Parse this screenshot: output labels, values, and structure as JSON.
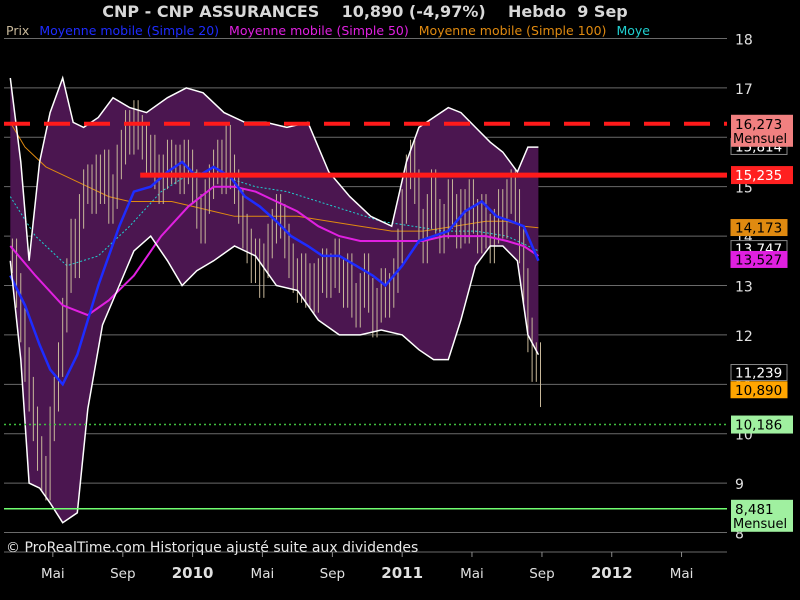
{
  "header": {
    "title": "CNP - CNP ASSURANCES    10,890 (-4,97%)    Hebdo  9 Sep"
  },
  "legend": [
    {
      "label": "Prix",
      "color": "#c8b89a"
    },
    {
      "label": "Moyenne mobile (Simple 20)",
      "color": "#1e2cff"
    },
    {
      "label": "Moyenne mobile (Simple 50)",
      "color": "#e020e0"
    },
    {
      "label": "Moyenne mobile (Simple 100)",
      "color": "#e08a10"
    },
    {
      "label": "Moye",
      "color": "#20d0d0"
    }
  ],
  "credit": "© ProRealTime.com Historique ajusté suite aux dividendes",
  "chart_data": {
    "type": "line",
    "colors": {
      "band_fill": "#4b1650",
      "band_edge": "#ffffff",
      "price": "#c8b89a",
      "sma20": "#1e2cff",
      "sma50": "#e020e0",
      "sma100": "#e08a10",
      "sma200": "#20d0d0",
      "resistance": "#ff1a1a",
      "support_dotted": "#40c040",
      "support_solid": "#70ff70"
    },
    "ylim": [
      7.9,
      18.1
    ],
    "yticks": [
      8,
      9,
      10,
      11,
      12,
      13,
      14,
      15,
      16,
      17,
      18
    ],
    "xlim": [
      2009.1,
      2012.55
    ],
    "xticks": [
      {
        "x": 2009.333,
        "label": "Mai",
        "bold": false
      },
      {
        "x": 2009.667,
        "label": "Sep",
        "bold": false
      },
      {
        "x": 2010.0,
        "label": "2010",
        "bold": true
      },
      {
        "x": 2010.333,
        "label": "Mai",
        "bold": false
      },
      {
        "x": 2010.667,
        "label": "Sep",
        "bold": false
      },
      {
        "x": 2011.0,
        "label": "2011",
        "bold": true
      },
      {
        "x": 2011.333,
        "label": "Mai",
        "bold": false
      },
      {
        "x": 2011.667,
        "label": "Sep",
        "bold": false
      },
      {
        "x": 2012.0,
        "label": "2012",
        "bold": true
      },
      {
        "x": 2012.333,
        "label": "Mai",
        "bold": false
      }
    ],
    "levels": [
      {
        "y": 16.273,
        "style": "dashed",
        "color": "#ff1a1a",
        "label": "16,273",
        "sublabel": "Mensuel",
        "box": "#f08080",
        "text": "#000000"
      },
      {
        "y": 15.235,
        "style": "solid",
        "color": "#ff1a1a",
        "x_from": 2009.75,
        "label": "15,235",
        "sublabel": "",
        "box": "#ff2020",
        "text": "#ffffff"
      },
      {
        "y": 10.186,
        "style": "dotted",
        "color": "#40c040",
        "label": "10,186",
        "sublabel": "",
        "box": "#a0f0a0",
        "text": "#000000"
      },
      {
        "y": 8.481,
        "style": "solid",
        "color": "#70ff70",
        "label": "8,481",
        "sublabel": "Mensuel",
        "box": "#a0f0a0",
        "text": "#000000"
      }
    ],
    "value_tags": [
      {
        "label": "15,814",
        "y": 15.814,
        "box": "#000000",
        "text": "#ffffff",
        "border": "#888888"
      },
      {
        "label": "14,173",
        "y": 14.173,
        "box": "#e08a10",
        "text": "#000000",
        "border": "#e08a10"
      },
      {
        "label": "13,747",
        "y": 13.747,
        "box": "#000000",
        "text": "#ffffff",
        "border": "#888888"
      },
      {
        "label": "13,527",
        "y": 13.527,
        "box": "#e020e0",
        "text": "#000000",
        "border": "#e020e0"
      },
      {
        "label": "11,239",
        "y": 11.239,
        "box": "#000000",
        "text": "#ffffff",
        "border": "#888888"
      },
      {
        "label": "10,890",
        "y": 10.89,
        "box": "#ffa500",
        "text": "#000000",
        "border": "#ffa500"
      }
    ],
    "bollinger_upper": [
      [
        2009.13,
        17.2
      ],
      [
        2009.18,
        15.5
      ],
      [
        2009.22,
        13.5
      ],
      [
        2009.27,
        15.5
      ],
      [
        2009.32,
        16.5
      ],
      [
        2009.38,
        17.2
      ],
      [
        2009.43,
        16.3
      ],
      [
        2009.48,
        16.2
      ],
      [
        2009.55,
        16.4
      ],
      [
        2009.62,
        16.8
      ],
      [
        2009.7,
        16.6
      ],
      [
        2009.78,
        16.5
      ],
      [
        2009.88,
        16.8
      ],
      [
        2009.97,
        17.0
      ],
      [
        2010.05,
        16.9
      ],
      [
        2010.15,
        16.5
      ],
      [
        2010.25,
        16.3
      ],
      [
        2010.35,
        16.3
      ],
      [
        2010.45,
        16.2
      ],
      [
        2010.55,
        16.3
      ],
      [
        2010.65,
        15.3
      ],
      [
        2010.75,
        14.8
      ],
      [
        2010.85,
        14.4
      ],
      [
        2010.95,
        14.2
      ],
      [
        2011.02,
        15.5
      ],
      [
        2011.08,
        16.2
      ],
      [
        2011.15,
        16.4
      ],
      [
        2011.22,
        16.6
      ],
      [
        2011.28,
        16.5
      ],
      [
        2011.35,
        16.2
      ],
      [
        2011.42,
        15.9
      ],
      [
        2011.48,
        15.7
      ],
      [
        2011.55,
        15.3
      ],
      [
        2011.6,
        15.8
      ],
      [
        2011.65,
        15.8
      ]
    ],
    "bollinger_lower": [
      [
        2009.13,
        13.5
      ],
      [
        2009.18,
        11.5
      ],
      [
        2009.22,
        9.0
      ],
      [
        2009.27,
        8.9
      ],
      [
        2009.32,
        8.6
      ],
      [
        2009.38,
        8.2
      ],
      [
        2009.45,
        8.4
      ],
      [
        2009.5,
        10.5
      ],
      [
        2009.57,
        12.2
      ],
      [
        2009.65,
        13.0
      ],
      [
        2009.72,
        13.7
      ],
      [
        2009.8,
        14.0
      ],
      [
        2009.88,
        13.5
      ],
      [
        2009.95,
        13.0
      ],
      [
        2010.02,
        13.3
      ],
      [
        2010.1,
        13.5
      ],
      [
        2010.2,
        13.8
      ],
      [
        2010.3,
        13.6
      ],
      [
        2010.4,
        13.0
      ],
      [
        2010.5,
        12.9
      ],
      [
        2010.6,
        12.3
      ],
      [
        2010.7,
        12.0
      ],
      [
        2010.8,
        12.0
      ],
      [
        2010.9,
        12.1
      ],
      [
        2011.0,
        12.0
      ],
      [
        2011.08,
        11.7
      ],
      [
        2011.15,
        11.5
      ],
      [
        2011.22,
        11.5
      ],
      [
        2011.28,
        12.3
      ],
      [
        2011.35,
        13.4
      ],
      [
        2011.42,
        13.8
      ],
      [
        2011.48,
        13.8
      ],
      [
        2011.55,
        13.5
      ],
      [
        2011.6,
        12.0
      ],
      [
        2011.65,
        11.6
      ]
    ],
    "sma20": [
      [
        2009.13,
        13.2
      ],
      [
        2009.2,
        12.6
      ],
      [
        2009.27,
        11.8
      ],
      [
        2009.32,
        11.3
      ],
      [
        2009.38,
        11.0
      ],
      [
        2009.45,
        11.6
      ],
      [
        2009.55,
        13.0
      ],
      [
        2009.65,
        14.2
      ],
      [
        2009.72,
        14.9
      ],
      [
        2009.8,
        15.0
      ],
      [
        2009.88,
        15.3
      ],
      [
        2009.95,
        15.5
      ],
      [
        2010.02,
        15.2
      ],
      [
        2010.1,
        15.4
      ],
      [
        2010.18,
        15.2
      ],
      [
        2010.25,
        14.8
      ],
      [
        2010.32,
        14.6
      ],
      [
        2010.4,
        14.3
      ],
      [
        2010.47,
        14.0
      ],
      [
        2010.55,
        13.8
      ],
      [
        2010.62,
        13.6
      ],
      [
        2010.7,
        13.6
      ],
      [
        2010.78,
        13.4
      ],
      [
        2010.86,
        13.2
      ],
      [
        2010.92,
        13.0
      ],
      [
        2011.0,
        13.4
      ],
      [
        2011.08,
        13.9
      ],
      [
        2011.15,
        14.0
      ],
      [
        2011.22,
        14.1
      ],
      [
        2011.3,
        14.5
      ],
      [
        2011.38,
        14.7
      ],
      [
        2011.45,
        14.4
      ],
      [
        2011.52,
        14.3
      ],
      [
        2011.58,
        14.2
      ],
      [
        2011.65,
        13.5
      ]
    ],
    "sma50": [
      [
        2009.13,
        13.8
      ],
      [
        2009.25,
        13.2
      ],
      [
        2009.38,
        12.6
      ],
      [
        2009.5,
        12.4
      ],
      [
        2009.6,
        12.7
      ],
      [
        2009.72,
        13.2
      ],
      [
        2009.85,
        14.0
      ],
      [
        2009.98,
        14.6
      ],
      [
        2010.1,
        15.0
      ],
      [
        2010.2,
        15.0
      ],
      [
        2010.3,
        14.9
      ],
      [
        2010.4,
        14.7
      ],
      [
        2010.5,
        14.5
      ],
      [
        2010.6,
        14.2
      ],
      [
        2010.7,
        14.0
      ],
      [
        2010.8,
        13.9
      ],
      [
        2010.9,
        13.9
      ],
      [
        2011.0,
        13.9
      ],
      [
        2011.1,
        13.9
      ],
      [
        2011.2,
        14.0
      ],
      [
        2011.3,
        14.0
      ],
      [
        2011.4,
        14.0
      ],
      [
        2011.5,
        13.9
      ],
      [
        2011.58,
        13.8
      ],
      [
        2011.65,
        13.6
      ]
    ],
    "sma100": [
      [
        2009.13,
        16.3
      ],
      [
        2009.2,
        15.8
      ],
      [
        2009.3,
        15.4
      ],
      [
        2009.4,
        15.2
      ],
      [
        2009.5,
        15.0
      ],
      [
        2009.6,
        14.8
      ],
      [
        2009.7,
        14.7
      ],
      [
        2009.8,
        14.7
      ],
      [
        2009.9,
        14.7
      ],
      [
        2010.0,
        14.6
      ],
      [
        2010.1,
        14.5
      ],
      [
        2010.2,
        14.4
      ],
      [
        2010.35,
        14.4
      ],
      [
        2010.5,
        14.4
      ],
      [
        2010.65,
        14.3
      ],
      [
        2010.8,
        14.2
      ],
      [
        2010.95,
        14.1
      ],
      [
        2011.1,
        14.1
      ],
      [
        2011.25,
        14.2
      ],
      [
        2011.4,
        14.3
      ],
      [
        2011.5,
        14.3
      ],
      [
        2011.58,
        14.2
      ],
      [
        2011.65,
        14.17
      ]
    ],
    "sma200": [
      [
        2009.13,
        14.8
      ],
      [
        2009.25,
        14.0
      ],
      [
        2009.4,
        13.4
      ],
      [
        2009.55,
        13.6
      ],
      [
        2009.7,
        14.2
      ],
      [
        2009.85,
        14.9
      ],
      [
        2010.0,
        15.3
      ],
      [
        2010.15,
        15.2
      ],
      [
        2010.3,
        15.0
      ],
      [
        2010.45,
        14.9
      ],
      [
        2010.6,
        14.7
      ],
      [
        2010.75,
        14.5
      ],
      [
        2010.9,
        14.3
      ],
      [
        2011.05,
        14.2
      ],
      [
        2011.2,
        14.1
      ],
      [
        2011.35,
        14.1
      ],
      [
        2011.5,
        14.0
      ],
      [
        2011.65,
        13.7
      ]
    ],
    "price_weekly": [
      [
        2009.14,
        13.6
      ],
      [
        2009.16,
        12.9
      ],
      [
        2009.18,
        12.2
      ],
      [
        2009.2,
        11.4
      ],
      [
        2009.22,
        10.8
      ],
      [
        2009.24,
        10.2
      ],
      [
        2009.26,
        9.6
      ],
      [
        2009.28,
        9.2
      ],
      [
        2009.3,
        9.0
      ],
      [
        2009.32,
        10.2
      ],
      [
        2009.34,
        10.8
      ],
      [
        2009.36,
        11.5
      ],
      [
        2009.38,
        12.4
      ],
      [
        2009.4,
        13.2
      ],
      [
        2009.42,
        14.0
      ],
      [
        2009.44,
        13.5
      ],
      [
        2009.46,
        14.5
      ],
      [
        2009.48,
        15.0
      ],
      [
        2009.5,
        15.1
      ],
      [
        2009.52,
        14.8
      ],
      [
        2009.54,
        15.3
      ],
      [
        2009.56,
        15.0
      ],
      [
        2009.58,
        15.4
      ],
      [
        2009.6,
        14.6
      ],
      [
        2009.62,
        14.9
      ],
      [
        2009.64,
        15.5
      ],
      [
        2009.66,
        15.8
      ],
      [
        2009.68,
        16.2
      ],
      [
        2009.7,
        16.0
      ],
      [
        2009.72,
        16.4
      ],
      [
        2009.74,
        16.1
      ],
      [
        2009.76,
        15.9
      ],
      [
        2009.78,
        15.6
      ],
      [
        2009.8,
        15.7
      ],
      [
        2009.82,
        15.3
      ],
      [
        2009.84,
        15.0
      ],
      [
        2009.86,
        15.3
      ],
      [
        2009.88,
        15.6
      ],
      [
        2009.9,
        15.4
      ],
      [
        2009.92,
        15.5
      ],
      [
        2009.94,
        15.2
      ],
      [
        2009.96,
        15.6
      ],
      [
        2009.98,
        15.4
      ],
      [
        2010.0,
        15.0
      ],
      [
        2010.02,
        14.5
      ],
      [
        2010.04,
        14.2
      ],
      [
        2010.06,
        14.8
      ],
      [
        2010.08,
        15.1
      ],
      [
        2010.1,
        15.4
      ],
      [
        2010.12,
        15.6
      ],
      [
        2010.14,
        15.2
      ],
      [
        2010.16,
        15.9
      ],
      [
        2010.18,
        15.3
      ],
      [
        2010.2,
        15.0
      ],
      [
        2010.22,
        14.6
      ],
      [
        2010.24,
        14.1
      ],
      [
        2010.26,
        13.8
      ],
      [
        2010.28,
        13.4
      ],
      [
        2010.3,
        13.6
      ],
      [
        2010.32,
        13.1
      ],
      [
        2010.34,
        13.5
      ],
      [
        2010.36,
        13.9
      ],
      [
        2010.38,
        14.2
      ],
      [
        2010.4,
        14.5
      ],
      [
        2010.42,
        14.3
      ],
      [
        2010.44,
        13.9
      ],
      [
        2010.46,
        13.5
      ],
      [
        2010.48,
        13.2
      ],
      [
        2010.5,
        13.0
      ],
      [
        2010.52,
        13.3
      ],
      [
        2010.54,
        12.9
      ],
      [
        2010.56,
        13.1
      ],
      [
        2010.58,
        12.8
      ],
      [
        2010.6,
        13.2
      ],
      [
        2010.62,
        13.4
      ],
      [
        2010.64,
        13.1
      ],
      [
        2010.66,
        13.3
      ],
      [
        2010.68,
        13.6
      ],
      [
        2010.7,
        13.2
      ],
      [
        2010.72,
        12.9
      ],
      [
        2010.74,
        13.3
      ],
      [
        2010.76,
        12.7
      ],
      [
        2010.78,
        12.5
      ],
      [
        2010.8,
        12.9
      ],
      [
        2010.82,
        13.3
      ],
      [
        2010.84,
        12.8
      ],
      [
        2010.86,
        12.3
      ],
      [
        2010.88,
        12.6
      ],
      [
        2010.9,
        13.0
      ],
      [
        2010.92,
        12.7
      ],
      [
        2010.94,
        12.9
      ],
      [
        2010.96,
        13.2
      ],
      [
        2010.98,
        13.8
      ],
      [
        2011.0,
        14.6
      ],
      [
        2011.02,
        15.3
      ],
      [
        2011.04,
        15.6
      ],
      [
        2011.06,
        15.0
      ],
      [
        2011.08,
        14.2
      ],
      [
        2011.1,
        13.8
      ],
      [
        2011.12,
        14.5
      ],
      [
        2011.14,
        15.0
      ],
      [
        2011.16,
        14.4
      ],
      [
        2011.18,
        14.0
      ],
      [
        2011.2,
        14.3
      ],
      [
        2011.22,
        14.8
      ],
      [
        2011.24,
        14.5
      ],
      [
        2011.26,
        14.1
      ],
      [
        2011.28,
        14.6
      ],
      [
        2011.3,
        14.2
      ],
      [
        2011.32,
        14.8
      ],
      [
        2011.34,
        14.4
      ],
      [
        2011.36,
        14.0
      ],
      [
        2011.38,
        14.5
      ],
      [
        2011.4,
        14.1
      ],
      [
        2011.42,
        13.8
      ],
      [
        2011.44,
        14.2
      ],
      [
        2011.46,
        14.6
      ],
      [
        2011.48,
        14.3
      ],
      [
        2011.5,
        14.8
      ],
      [
        2011.52,
        15.0
      ],
      [
        2011.54,
        14.6
      ],
      [
        2011.56,
        13.8
      ],
      [
        2011.58,
        13.0
      ],
      [
        2011.6,
        12.0
      ],
      [
        2011.62,
        11.4
      ],
      [
        2011.64,
        11.5
      ],
      [
        2011.66,
        10.89
      ]
    ]
  }
}
